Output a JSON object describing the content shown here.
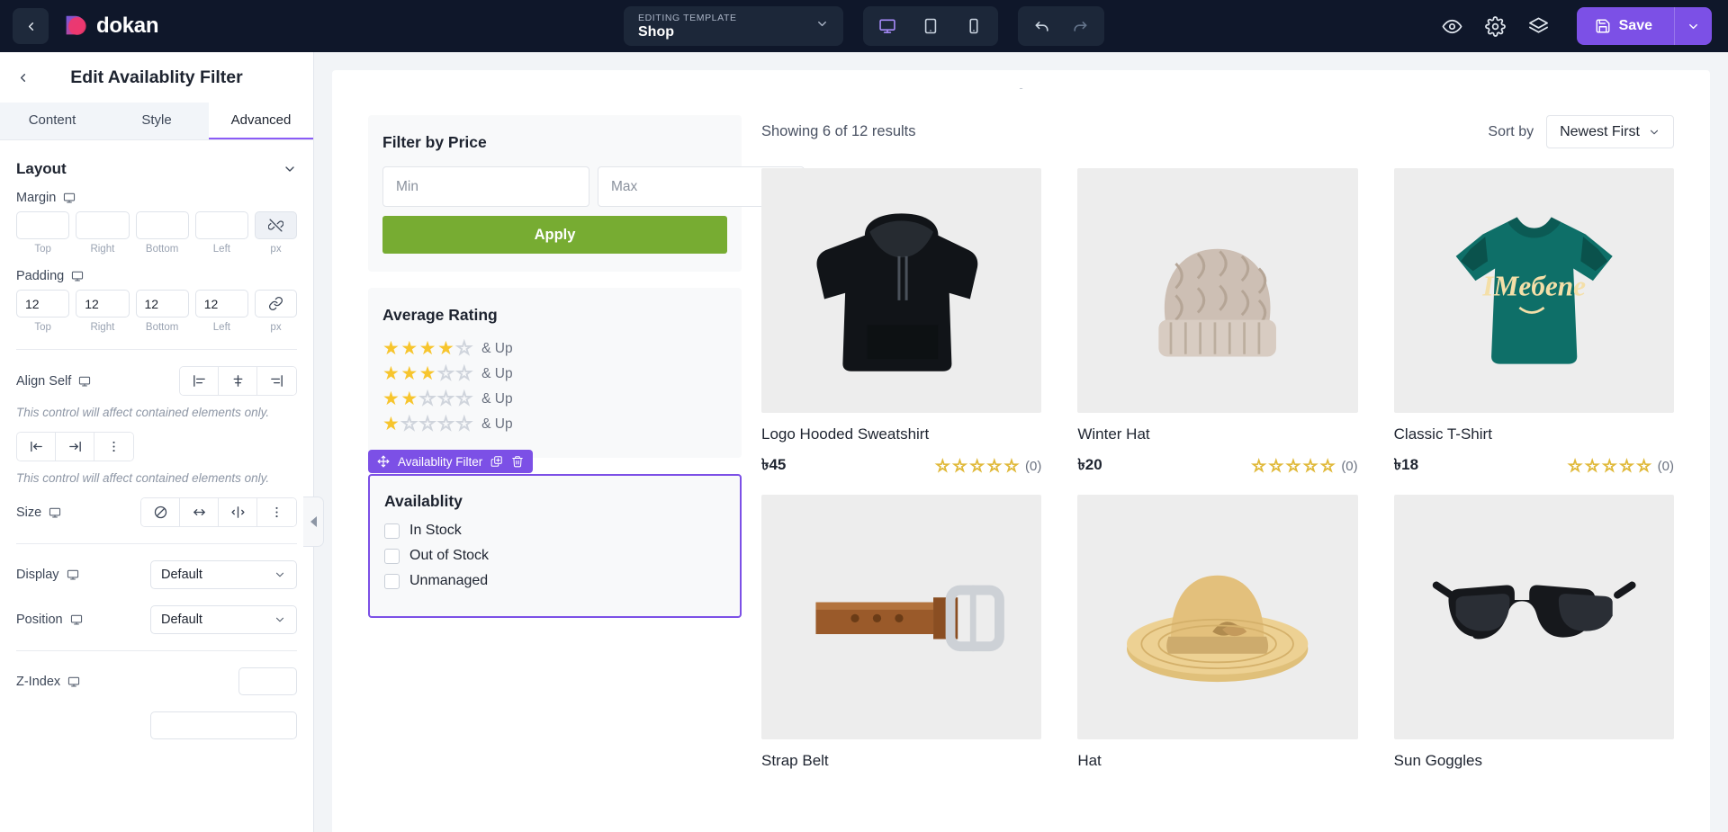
{
  "topbar": {
    "back_icon": "chevron-left-icon",
    "brand": "dokan",
    "template": {
      "label": "EDITING TEMPLATE",
      "value": "Shop",
      "caret": "chevron-down-icon"
    },
    "devices": [
      {
        "name": "desktop",
        "icon": "desktop-icon",
        "active": true
      },
      {
        "name": "tablet",
        "icon": "tablet-icon",
        "active": false
      },
      {
        "name": "mobile",
        "icon": "mobile-icon",
        "active": false
      }
    ],
    "history": [
      {
        "name": "undo",
        "icon": "undo-icon"
      },
      {
        "name": "redo",
        "icon": "redo-icon"
      }
    ],
    "actions": [
      {
        "name": "preview",
        "icon": "eye-icon"
      },
      {
        "name": "settings",
        "icon": "gear-icon"
      },
      {
        "name": "layers",
        "icon": "layers-icon"
      }
    ],
    "save": {
      "label": "Save",
      "icon": "floppy-disk-icon",
      "caret": "chevron-down-icon",
      "color": "#7c50e6"
    }
  },
  "sidebar": {
    "back_icon": "chevron-left-icon",
    "title": "Edit Availablity Filter",
    "tabs": [
      {
        "label": "Content",
        "active": false
      },
      {
        "label": "Style",
        "active": false
      },
      {
        "label": "Advanced",
        "active": true
      }
    ],
    "sections": [
      {
        "title": "Layout",
        "caret": "chevron-down-icon"
      }
    ],
    "margin": {
      "label": "Margin",
      "device_icon": "desktop-icon",
      "values": [
        "",
        "",
        "",
        ""
      ],
      "captions": [
        "Top",
        "Right",
        "Bottom",
        "Left"
      ],
      "unit": "px",
      "link_icon": "link-broken-icon",
      "linked": false
    },
    "padding": {
      "label": "Padding",
      "device_icon": "desktop-icon",
      "values": [
        "12",
        "12",
        "12",
        "12"
      ],
      "captions": [
        "Top",
        "Right",
        "Bottom",
        "Left"
      ],
      "unit": "px",
      "link_icon": "link-icon",
      "linked": true
    },
    "align_self": {
      "label": "Align Self",
      "device_icon": "desktop-icon",
      "options": [
        "align-start-icon",
        "align-center-icon",
        "align-end-icon"
      ],
      "note": "This control will affect contained elements only."
    },
    "justify": {
      "options": [
        "justify-start-icon",
        "justify-end-icon",
        "more-vertical-icon"
      ],
      "note": "This control will affect contained elements only."
    },
    "size": {
      "label": "Size",
      "device_icon": "desktop-icon",
      "options": [
        "none-icon",
        "expand-icon",
        "shrink-icon",
        "more-vertical-icon"
      ]
    },
    "display": {
      "label": "Display",
      "device_icon": "desktop-icon",
      "value": "Default",
      "caret": "chevron-down-icon"
    },
    "position": {
      "label": "Position",
      "device_icon": "desktop-icon",
      "value": "Default",
      "caret": "chevron-down-icon"
    },
    "z_index": {
      "label": "Z-Index",
      "device_icon": "desktop-icon",
      "value": ""
    },
    "collapse_icon": "collapse-left-icon"
  },
  "canvas": {
    "top_marker": "-",
    "price_filter": {
      "title": "Filter by Price",
      "min_placeholder": "Min",
      "max_placeholder": "Max",
      "min_value": "",
      "max_value": "",
      "apply_label": "Apply",
      "apply_color": "#77ac32"
    },
    "rating_filter": {
      "title": "Average Rating",
      "suffix": "& Up",
      "rows": [
        4,
        3,
        2,
        1
      ],
      "max_stars": 5,
      "star_color": "#f7c52d"
    },
    "availability_widget": {
      "badge_label": "Availablity Filter",
      "badge_color": "#7c50e6",
      "badge_icons": [
        "move-handle-icon",
        "duplicate-icon",
        "trash-icon"
      ],
      "title": "Availablity",
      "options": [
        {
          "label": "In Stock",
          "checked": false
        },
        {
          "label": "Out of Stock",
          "checked": false
        },
        {
          "label": "Unmanaged",
          "checked": false
        }
      ]
    },
    "results": {
      "showing": "Showing 6 of 12 results",
      "sort_label": "Sort by",
      "sort_value": "Newest First",
      "sort_caret": "chevron-down-icon"
    },
    "products": [
      {
        "name": "Logo Hooded Sweatshirt",
        "price": "৳45",
        "rating": 0,
        "review_count": "(0)",
        "image": "black-hoodie"
      },
      {
        "name": "Winter Hat",
        "price": "৳20",
        "rating": 0,
        "review_count": "(0)",
        "image": "knit-beanie"
      },
      {
        "name": "Classic T-Shirt",
        "price": "৳18",
        "rating": 0,
        "review_count": "(0)",
        "image": "teal-tshirt"
      },
      {
        "name": "Strap Belt",
        "price": "",
        "rating": 0,
        "review_count": "",
        "image": "brown-belt"
      },
      {
        "name": "Hat",
        "price": "",
        "rating": 0,
        "review_count": "",
        "image": "straw-hat"
      },
      {
        "name": "Sun Goggles",
        "price": "",
        "rating": 0,
        "review_count": "",
        "image": "sunglasses"
      }
    ]
  }
}
